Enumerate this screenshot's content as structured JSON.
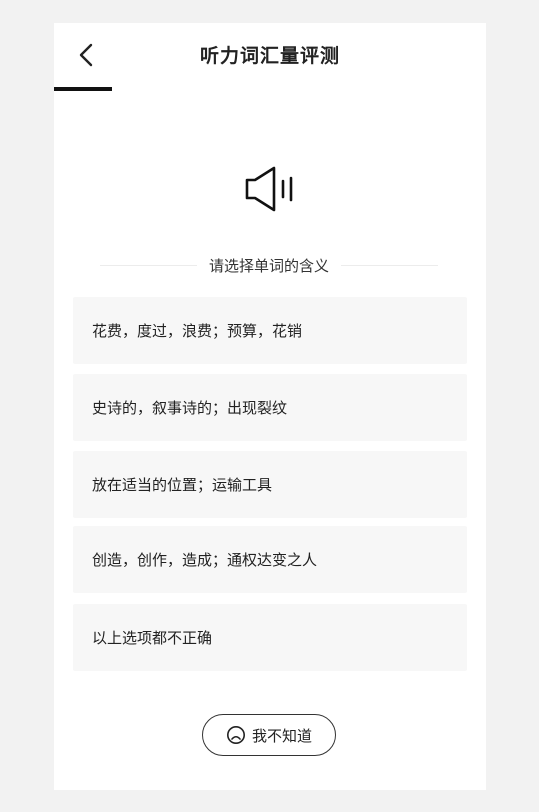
{
  "header": {
    "title": "听力词汇量评测"
  },
  "progress": {
    "fraction": 0.135
  },
  "prompt": {
    "text": "请选择单词的含义"
  },
  "options": [
    {
      "label": "花费，度过，浪费；预算，花销"
    },
    {
      "label": "史诗的，叙事诗的；出现裂纹"
    },
    {
      "label": "放在适当的位置；运输工具"
    },
    {
      "label": "创造，创作，造成；通权达变之人"
    },
    {
      "label": "以上选项都不正确"
    }
  ],
  "dont_know": {
    "label": "我不知道"
  },
  "icons": {
    "back": "chevron-left-icon",
    "speaker": "speaker-icon",
    "face": "sad-face-icon"
  },
  "colors": {
    "background": "#f2f2f2",
    "card": "#ffffff",
    "option_bg": "#f7f7f7",
    "text": "#222222",
    "progress": "#111111"
  }
}
